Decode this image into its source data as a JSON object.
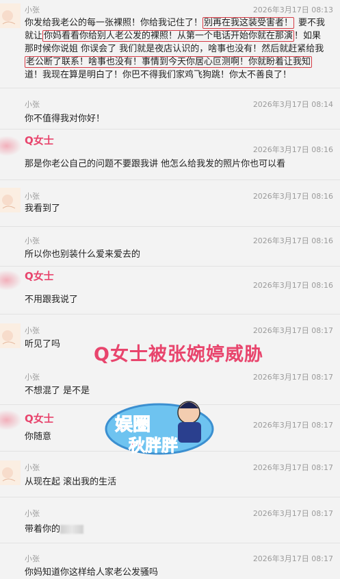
{
  "colors": {
    "accent": "#e8456d",
    "highlight_box": "#d63a44",
    "timestamp": "#9a9a9a"
  },
  "messages": [
    {
      "sender": "小张",
      "time": "2026年3月17日 08:13",
      "lines": [
        [
          "你发给我老公的每一张裸照！你给我记住了！",
          "别再在我这装受害者！",
          "要不我"
        ],
        [
          "就让",
          "你妈看看你给别人老公发的裸照！从第一个电话开始你就在那演",
          "！如果"
        ],
        [
          "那时候你说姐 你误会了 我们就是夜店认识的，啥事也没有！然后就赶紧给我",
          "",
          ""
        ],
        [
          "",
          "老公断了联系！啥事也没有！事情到今天你居心叵测啊！你就盼着让我知",
          ""
        ],
        [
          "道！我现在算是明白了！你巴不得我们家鸡飞狗跳！你太不善良了！",
          "",
          ""
        ]
      ]
    },
    {
      "sender": "小张",
      "time": "2026年3月17日 08:14",
      "text": "你不值得我对你好！"
    },
    {
      "sender": "Q女士",
      "time": "2026年3月17日 08:16",
      "text": "那是你老公自己的问题不要跟我讲 他怎么给我发的照片你也可以看"
    },
    {
      "sender": "小张",
      "time": "2026年3月17日 08:16",
      "text": "我看到了"
    },
    {
      "sender": "小张",
      "time": "2026年3月17日 08:16",
      "text": "所以你也别装什么爱来爱去的"
    },
    {
      "sender": "Q女士",
      "time": "2026年3月17日 08:16",
      "text": "不用跟我说了"
    },
    {
      "sender": "小张",
      "time": "2026年3月17日 08:17",
      "text": "听见了吗"
    },
    {
      "sender": "小张",
      "time": "2026年3月17日 08:17",
      "text": "不想混了 是不是"
    },
    {
      "sender": "Q女士",
      "time": "2026年3月17日 08:17",
      "text": "你随意"
    },
    {
      "sender": "小张",
      "time": "2026年3月17日 08:17",
      "text": "从现在起 滚出我的生活"
    },
    {
      "sender": "小张",
      "time": "2026年3月17日 08:17",
      "text": "带着你的"
    },
    {
      "sender": "小张",
      "time": "2026年3月17日 08:17",
      "text": "你妈知道你这样给人家老公发骚吗"
    }
  ],
  "overlay": {
    "caption": "Q女士被张婉婷威胁",
    "logo_text": "娱圈秋胖胖"
  }
}
